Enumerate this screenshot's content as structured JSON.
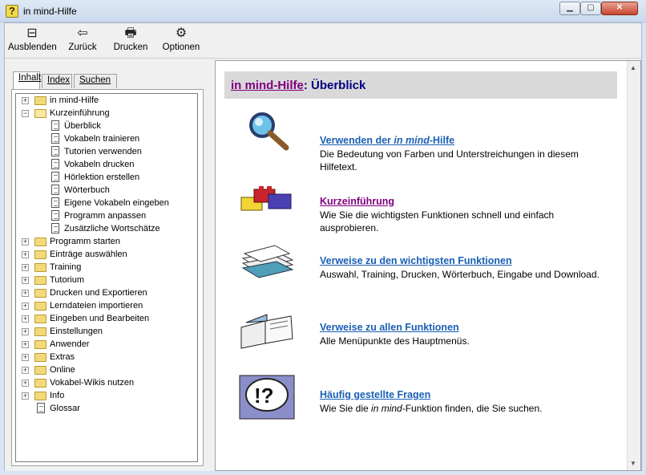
{
  "window": {
    "title": "in mind-Hilfe"
  },
  "toolbar": {
    "buttons": [
      {
        "label": "Ausblenden",
        "icon": "hide-pane-icon"
      },
      {
        "label": "Zurück",
        "icon": "back-arrow-icon"
      },
      {
        "label": "Drucken",
        "icon": "printer-icon"
      },
      {
        "label": "Optionen",
        "icon": "options-icon"
      }
    ]
  },
  "tabs": [
    {
      "label": "Inhalt",
      "active": true
    },
    {
      "label": "Index",
      "active": false
    },
    {
      "label": "Suchen",
      "active": false
    }
  ],
  "tree": [
    {
      "label": "in mind-Hilfe",
      "type": "folder",
      "expander": "+",
      "level": 0
    },
    {
      "label": "Kurzeinführung",
      "type": "folder-open",
      "expander": "−",
      "level": 0
    },
    {
      "label": "Überblick",
      "type": "page",
      "level": 1
    },
    {
      "label": "Vokabeln trainieren",
      "type": "page",
      "level": 1
    },
    {
      "label": "Tutorien verwenden",
      "type": "page",
      "level": 1
    },
    {
      "label": "Vokabeln drucken",
      "type": "page",
      "level": 1
    },
    {
      "label": "Hörlektion erstellen",
      "type": "page",
      "level": 1
    },
    {
      "label": "Wörterbuch",
      "type": "page",
      "level": 1
    },
    {
      "label": "Eigene Vokabeln eingeben",
      "type": "page",
      "level": 1
    },
    {
      "label": "Programm anpassen",
      "type": "page",
      "level": 1
    },
    {
      "label": "Zusätzliche Wortschätze",
      "type": "page",
      "level": 1
    },
    {
      "label": "Programm starten",
      "type": "folder",
      "expander": "+",
      "level": 0
    },
    {
      "label": "Einträge auswählen",
      "type": "folder",
      "expander": "+",
      "level": 0
    },
    {
      "label": "Training",
      "type": "folder",
      "expander": "+",
      "level": 0
    },
    {
      "label": "Tutorium",
      "type": "folder",
      "expander": "+",
      "level": 0
    },
    {
      "label": "Drucken und Exportieren",
      "type": "folder",
      "expander": "+",
      "level": 0
    },
    {
      "label": "Lerndateien importieren",
      "type": "folder",
      "expander": "+",
      "level": 0
    },
    {
      "label": "Eingeben und Bearbeiten",
      "type": "folder",
      "expander": "+",
      "level": 0
    },
    {
      "label": "Einstellungen",
      "type": "folder",
      "expander": "+",
      "level": 0
    },
    {
      "label": "Anwender",
      "type": "folder",
      "expander": "+",
      "level": 0
    },
    {
      "label": "Extras",
      "type": "folder",
      "expander": "+",
      "level": 0
    },
    {
      "label": "Online",
      "type": "folder",
      "expander": "+",
      "level": 0
    },
    {
      "label": "Vokabel-Wikis nutzen",
      "type": "folder",
      "expander": "+",
      "level": 0
    },
    {
      "label": "Info",
      "type": "folder",
      "expander": "+",
      "level": 0
    },
    {
      "label": "Glossar",
      "type": "page",
      "level": 0
    }
  ],
  "content": {
    "title_link": "in mind-Hilfe",
    "title_rest": ": Überblick",
    "entries": [
      {
        "link_pre": "Verwenden der ",
        "link_italic": "in mind",
        "link_post": "-Hilfe",
        "desc_pre": "Die Bedeutung von Farben und Unterstreichungen in diesem Hilfetext.",
        "desc_italic": "",
        "desc_post": "",
        "icon": "magnifier-icon",
        "visited": false
      },
      {
        "link_pre": "Kurzeinführung",
        "link_italic": "",
        "link_post": "",
        "desc_pre": "Wie Sie die wichtigsten Funktionen schnell und einfach ausprobieren.",
        "desc_italic": "",
        "desc_post": "",
        "icon": "building-blocks-icon",
        "visited": true
      },
      {
        "link_pre": "Verweise zu den wichtigsten Funktionen",
        "link_italic": "",
        "link_post": "",
        "desc_pre": "Auswahl, Training, Drucken, Wörterbuch, Eingabe und Download.",
        "desc_italic": "",
        "desc_post": "",
        "icon": "paper-stack-icon",
        "visited": false
      },
      {
        "link_pre": "Verweise zu allen Funktionen",
        "link_italic": "",
        "link_post": "",
        "desc_pre": "Alle Menüpunkte des Hauptmenüs.",
        "desc_italic": "",
        "desc_post": "",
        "icon": "open-book-icon",
        "visited": false
      },
      {
        "link_pre": "Häufig gestellte Fragen",
        "link_italic": "",
        "link_post": "",
        "desc_pre": "Wie Sie die ",
        "desc_italic": "in mind",
        "desc_post": "-Funktion finden, die Sie suchen.",
        "icon": "question-exclamation-icon",
        "visited": false
      }
    ]
  },
  "colors": {
    "link": "#1a5fb4",
    "visited": "#800080",
    "header_text": "#000080",
    "header_bg": "#d9d9d9"
  }
}
